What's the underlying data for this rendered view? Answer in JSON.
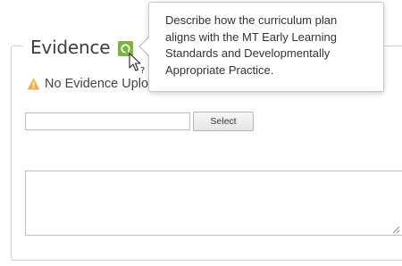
{
  "evidence": {
    "title": "Evidence",
    "help_icon": "question-mark-icon",
    "accent_color": "#7cb342"
  },
  "status": {
    "icon": "warning-icon",
    "icon_color": "#f0ad4e",
    "text": "No Evidence Uplo"
  },
  "upload": {
    "file_value": "",
    "select_label": "Select"
  },
  "comment": {
    "value": ""
  },
  "tooltip": {
    "lines": [
      "Describe how the curriculum plan",
      "aligns with the MT Early Learning",
      "Standards and Developmentally",
      "Appropriate Practice."
    ]
  }
}
